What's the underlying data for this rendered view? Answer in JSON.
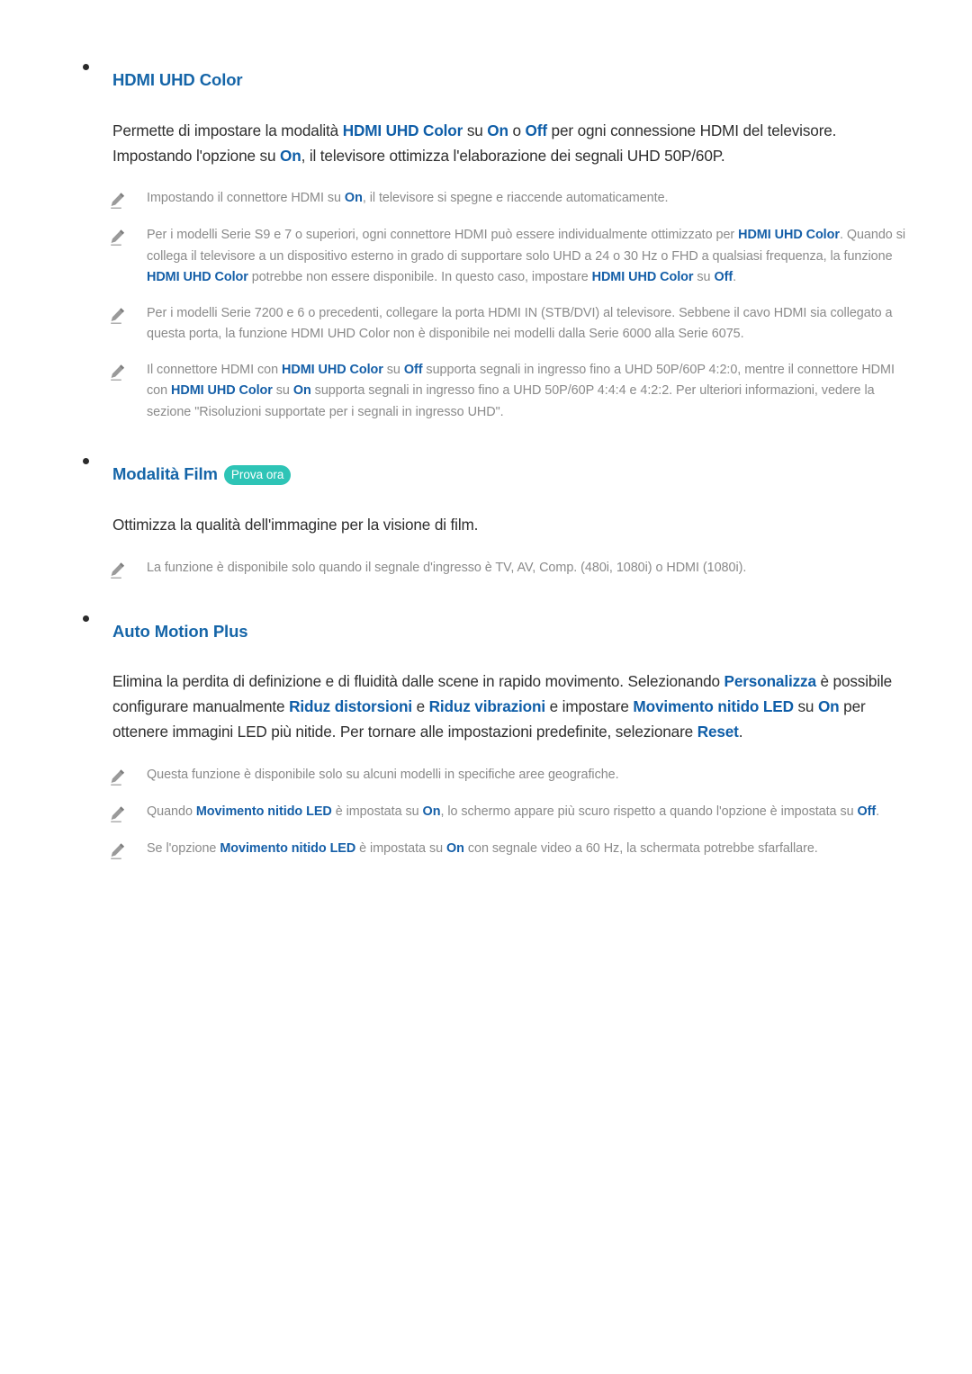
{
  "page": {
    "language": "it",
    "colors": {
      "heading_blue": "#1565a8",
      "emphasis_blue": "#0f5ea8",
      "note_emphasis_blue": "#155fa8",
      "body_text": "#2f2f2f",
      "note_text": "#8a8a8a",
      "badge_teal": "#2ec4b6",
      "bullet_dot": "#2b2b2b",
      "background": "#ffffff"
    }
  },
  "sections": [
    {
      "id": "hdmi-uhd-color",
      "title": "HDMI UHD Color",
      "badge": null,
      "paragraph": {
        "full": "Permette di impostare la modalità HDMI UHD Color su On o Off per ogni connessione HDMI del televisore. Impostando l'opzione su On, il televisore ottimizza l'elaborazione dei segnali UHD 50P/60P.",
        "p1": "Permette di impostare la modalità ",
        "e1": "HDMI UHD Color",
        "p2": " su ",
        "e2": "On",
        "p3": " o ",
        "e3": "Off",
        "p4": " per ogni connessione HDMI del televisore. Impostando l'opzione su ",
        "e4": "On",
        "p5": ", il televisore ottimizza l'elaborazione dei segnali UHD 50P/60P."
      },
      "notes": [
        {
          "icon": "pencil-note-icon",
          "full": "Impostando il connettore HDMI su On, il televisore si spegne e riaccende automaticamente.",
          "p1": "Impostando il connettore HDMI su ",
          "e1": "On",
          "p2": ", il televisore si spegne e riaccende automaticamente."
        },
        {
          "icon": "pencil-note-icon",
          "full": "Per i modelli Serie S9 e 7 o superiori, ogni connettore HDMI può essere individualmente ottimizzato per HDMI UHD Color. Quando si collega il televisore a un dispositivo esterno in grado di supportare solo UHD a 24 o 30 Hz o FHD a qualsiasi frequenza, la funzione HDMI UHD Color potrebbe non essere disponibile. In questo caso, impostare HDMI UHD Color su Off.",
          "p1": "Per i modelli Serie S9 e 7 o superiori, ogni connettore HDMI può essere individualmente ottimizzato per ",
          "e1": "HDMI UHD Color",
          "p2": ". Quando si collega il televisore a un dispositivo esterno in grado di supportare solo UHD a 24 o 30 Hz o FHD a qualsiasi frequenza, la funzione ",
          "e2": "HDMI UHD Color",
          "p3": " potrebbe non essere disponibile. In questo caso, impostare ",
          "e3": "HDMI UHD Color",
          "p4": " su ",
          "e4": "Off",
          "p5": "."
        },
        {
          "icon": "pencil-note-icon",
          "full": "Per i modelli Serie 7200 e 6 o precedenti, collegare la porta HDMI IN (STB/DVI) al televisore. Sebbene il cavo HDMI sia collegato a questa porta, la funzione HDMI UHD Color non è disponibile nei modelli dalla Serie 6000 alla Serie 6075.",
          "p1": "Per i modelli Serie 7200 e 6 o precedenti, collegare la porta HDMI IN (STB/DVI) al televisore. Sebbene il cavo HDMI sia collegato a questa porta, la funzione HDMI UHD Color non è disponibile nei modelli dalla Serie 6000 alla Serie 6075."
        },
        {
          "icon": "pencil-note-icon",
          "full": "Il connettore HDMI con HDMI UHD Color su Off supporta segnali in ingresso fino a UHD 50P/60P 4:2:0, mentre il connettore HDMI con HDMI UHD Color su On supporta segnali in ingresso fino a UHD 50P/60P 4:4:4 e 4:2:2. Per ulteriori informazioni, vedere la sezione \"Risoluzioni supportate per i segnali in ingresso UHD\".",
          "p1": "Il connettore HDMI con ",
          "e1": "HDMI UHD Color",
          "p2": " su ",
          "e2": "Off",
          "p3": " supporta segnali in ingresso fino a UHD 50P/60P 4:2:0, mentre il connettore HDMI con ",
          "e3": "HDMI UHD Color",
          "p4": " su ",
          "e4": "On",
          "p5": " supporta segnali in ingresso fino a UHD 50P/60P 4:4:4 e 4:2:2. Per ulteriori informazioni, vedere la sezione \"Risoluzioni supportate per i segnali in ingresso UHD\"."
        }
      ]
    },
    {
      "id": "modalita-film",
      "title": "Modalità Film",
      "badge": "Prova ora",
      "paragraph": {
        "full": "Ottimizza la qualità dell'immagine per la visione di film.",
        "p1": "Ottimizza la qualità dell'immagine per la visione di film."
      },
      "notes": [
        {
          "icon": "pencil-note-icon",
          "full": "La funzione è disponibile solo quando il segnale d'ingresso è TV, AV, Comp. (480i, 1080i) o HDMI (1080i).",
          "p1": "La funzione è disponibile solo quando il segnale d'ingresso è TV, AV, Comp. (480i, 1080i) o HDMI (1080i)."
        }
      ]
    },
    {
      "id": "auto-motion-plus",
      "title": "Auto Motion Plus",
      "badge": null,
      "paragraph": {
        "full": "Elimina la perdita di definizione e di fluidità dalle scene in rapido movimento. Selezionando Personalizza è possibile configurare manualmente Riduz distorsioni e Riduz vibrazioni e impostare Movimento nitido LED su On per ottenere immagini LED più nitide. Per tornare alle impostazioni predefinite, selezionare Reset.",
        "p1": "Elimina la perdita di definizione e di fluidità dalle scene in rapido movimento. Selezionando ",
        "e1": "Personalizza",
        "p2": " è possibile configurare manualmente ",
        "e2": "Riduz distorsioni",
        "p3": " e ",
        "e3": "Riduz vibrazioni",
        "p4": " e impostare ",
        "e4": "Movimento nitido LED",
        "p5": " su ",
        "e5": "On",
        "p6": " per ottenere immagini LED più nitide. Per tornare alle impostazioni predefinite, selezionare ",
        "e6": "Reset",
        "p7": "."
      },
      "notes": [
        {
          "icon": "pencil-note-icon",
          "full": "Questa funzione è disponibile solo su alcuni modelli in specifiche aree geografiche.",
          "p1": "Questa funzione è disponibile solo su alcuni modelli in specifiche aree geografiche."
        },
        {
          "icon": "pencil-note-icon",
          "full": "Quando Movimento nitido LED è impostata su On, lo schermo appare più scuro rispetto a quando l'opzione è impostata su Off.",
          "p1": "Quando ",
          "e1": "Movimento nitido LED",
          "p2": " è impostata su ",
          "e2": "On",
          "p3": ", lo schermo appare più scuro rispetto a quando l'opzione è impostata su ",
          "e3": "Off",
          "p4": "."
        },
        {
          "icon": "pencil-note-icon",
          "full": "Se l'opzione Movimento nitido LED è impostata su On con segnale video a 60 Hz, la schermata potrebbe sfarfallare.",
          "p1": "Se l'opzione ",
          "e1": "Movimento nitido LED",
          "p2": " è impostata su ",
          "e2": "On",
          "p3": " con segnale video a 60 Hz, la schermata potrebbe sfarfallare."
        }
      ]
    }
  ]
}
